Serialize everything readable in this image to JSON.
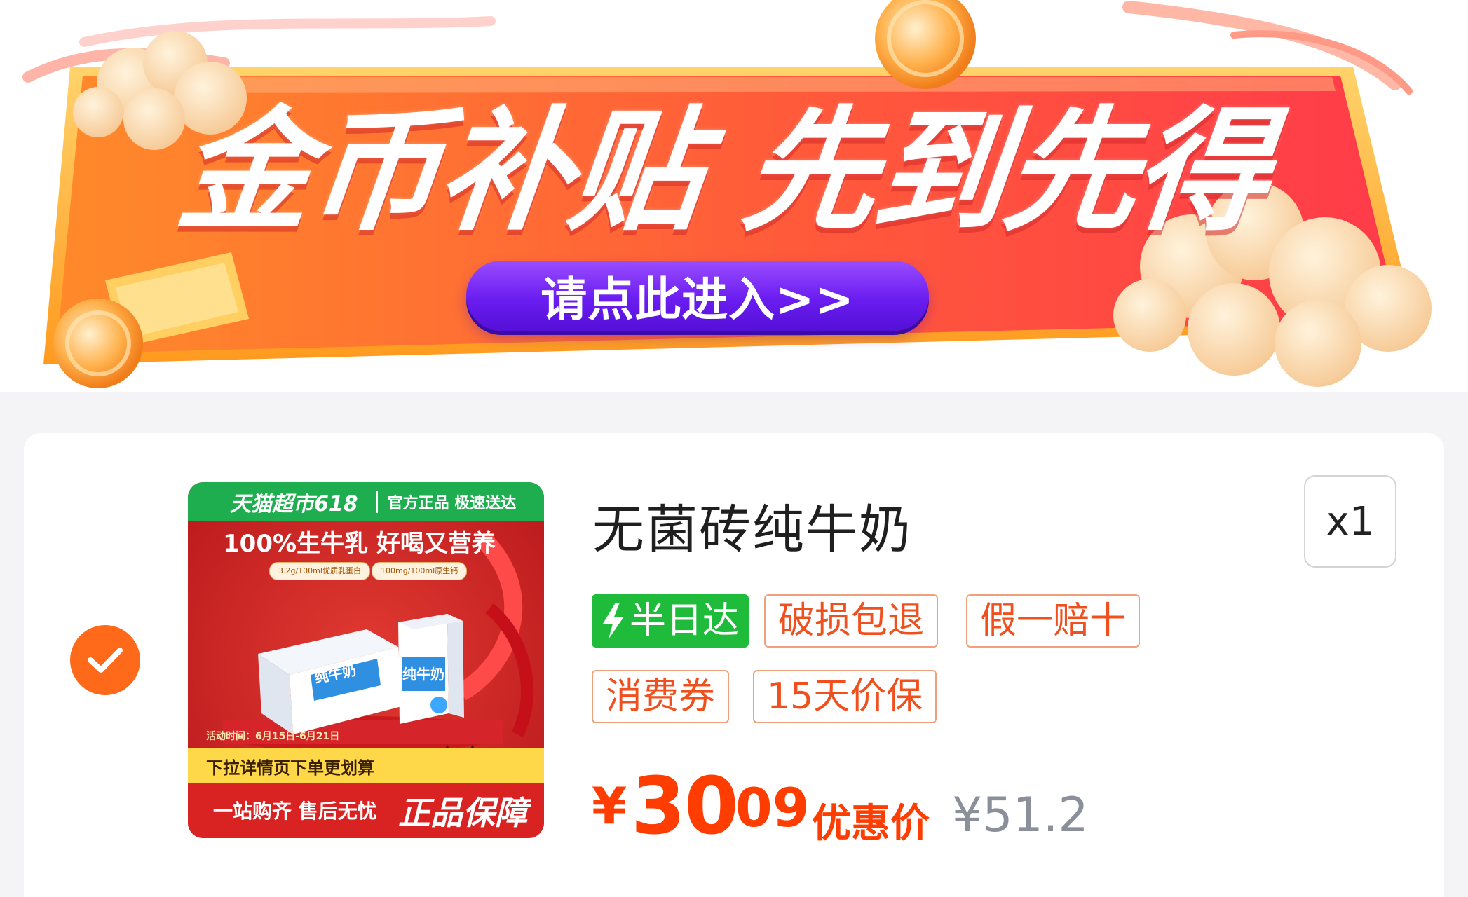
{
  "banner": {
    "title": "金币补贴 先到先得",
    "enter_button": "请点此进入>>"
  },
  "product": {
    "title": "无菌砖纯牛奶",
    "quantity": "x1",
    "image": {
      "top_brand": "天猫超市618",
      "top_slogan": "官方正品 极速送达",
      "headline": "100%生牛乳 好喝又营养",
      "spec_tag_1": "3.2g/100ml优质乳蛋白",
      "spec_tag_2": "100mg/100ml原生钙",
      "box_label_1": "纯牛奶",
      "box_label_2": "纯牛奶",
      "event_date": "活动时间：6月15日-6月21日",
      "strip_text": "下拉详情页下单更划算",
      "bottom_left": "一站购齐 售后无忧",
      "bottom_right": "正品保障"
    },
    "badges": {
      "delivery": "半日达",
      "items": [
        "破损包退",
        "假一赔十",
        "消费券",
        "15天价保"
      ]
    },
    "price": {
      "symbol": "¥",
      "integer": "30",
      "decimal": ".09",
      "label": "优惠价",
      "original": "¥51.2"
    }
  },
  "colors": {
    "accent": "#ff3d00",
    "badge_border": "#f0a07a",
    "delivery_green": "#1fbb3a",
    "check_orange": "#ff6a1a",
    "button_purple": "#6a1df0"
  },
  "icons": {
    "check": "check-icon",
    "lightning": "lightning-icon"
  }
}
